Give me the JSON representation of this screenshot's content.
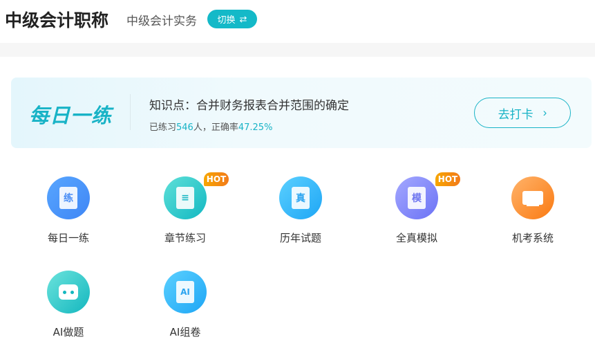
{
  "header": {
    "title": "中级会计职称",
    "subject": "中级会计实务",
    "switch_label": "切换",
    "switch_icon": "swap-arrows-icon"
  },
  "banner": {
    "heading": "每日一练",
    "knowledge_point": "知识点：合并财务报表合并范围的确定",
    "stats_prefix": "已练习",
    "practiced_count": "546",
    "stats_mid": "人，正确率",
    "accuracy": "47.25%",
    "button_label": "去打卡",
    "button_icon": "chevron-right-icon"
  },
  "menu": [
    {
      "label": "每日一练",
      "glyph": "练",
      "icon": "practice-scroll-icon"
    },
    {
      "label": "章节练习",
      "glyph": "",
      "icon": "document-icon",
      "badge": "HOT"
    },
    {
      "label": "历年试题",
      "glyph": "真",
      "icon": "exam-scroll-icon"
    },
    {
      "label": "全真模拟",
      "glyph": "模",
      "icon": "mock-scroll-icon",
      "badge": "HOT"
    },
    {
      "label": "机考系统",
      "glyph": "",
      "icon": "monitor-icon"
    },
    {
      "label": "AI做题",
      "glyph": "",
      "icon": "robot-icon"
    },
    {
      "label": "AI组卷",
      "glyph": "AI",
      "icon": "ai-scroll-icon"
    }
  ],
  "colors": {
    "accent": "#18b3c6",
    "hot": "#f7a600"
  }
}
